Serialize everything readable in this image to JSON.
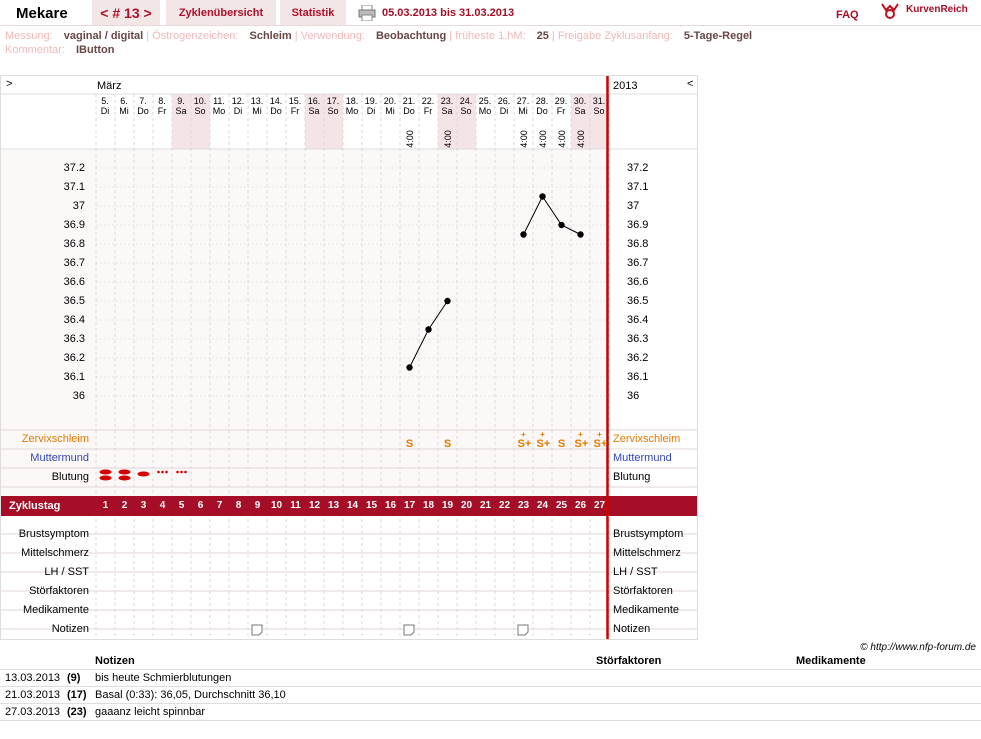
{
  "header": {
    "name": "Mekare",
    "cycle": "< # 13 >",
    "tabs": [
      "Zyklenübersicht",
      "Statistik"
    ],
    "date_range": "05.03.2013 bis 31.03.2013",
    "faq": "FAQ",
    "brand": "KurvenReich"
  },
  "info": {
    "measurement_label": "Messung:",
    "measurement": "vaginal / digital",
    "estrogen_label": "Östrogenzeichen:",
    "estrogen": "Schleim",
    "use_label": "Verwendung:",
    "use": "Beobachtung",
    "earliest_label": "früheste 1.hM:",
    "earliest": "25",
    "release_label": "Freigabe Zyklusanfang:",
    "release": "5-Tage-Regel",
    "comment_label": "Kommentar:",
    "comment": "IButton"
  },
  "chart": {
    "month": "März",
    "year": "2013",
    "nav_left": ">",
    "nav_right": "<",
    "days": [
      {
        "d": "5.",
        "w": "Di",
        "we": false
      },
      {
        "d": "6.",
        "w": "Mi",
        "we": false
      },
      {
        "d": "7.",
        "w": "Do",
        "we": false
      },
      {
        "d": "8.",
        "w": "Fr",
        "we": false
      },
      {
        "d": "9.",
        "w": "Sa",
        "we": true
      },
      {
        "d": "10.",
        "w": "So",
        "we": true
      },
      {
        "d": "11.",
        "w": "Mo",
        "we": false
      },
      {
        "d": "12.",
        "w": "Di",
        "we": false
      },
      {
        "d": "13.",
        "w": "Mi",
        "we": false
      },
      {
        "d": "14.",
        "w": "Do",
        "we": false
      },
      {
        "d": "15.",
        "w": "Fr",
        "we": false
      },
      {
        "d": "16.",
        "w": "Sa",
        "we": true
      },
      {
        "d": "17.",
        "w": "So",
        "we": true
      },
      {
        "d": "18.",
        "w": "Mo",
        "we": false
      },
      {
        "d": "19.",
        "w": "Di",
        "we": false
      },
      {
        "d": "20.",
        "w": "Mi",
        "we": false
      },
      {
        "d": "21.",
        "w": "Do",
        "we": false
      },
      {
        "d": "22.",
        "w": "Fr",
        "we": false
      },
      {
        "d": "23.",
        "w": "Sa",
        "we": true
      },
      {
        "d": "24.",
        "w": "So",
        "we": true
      },
      {
        "d": "25.",
        "w": "Mo",
        "we": false
      },
      {
        "d": "26.",
        "w": "Di",
        "we": false
      },
      {
        "d": "27.",
        "w": "Mi",
        "we": false
      },
      {
        "d": "28.",
        "w": "Do",
        "we": false
      },
      {
        "d": "29.",
        "w": "Fr",
        "we": false
      },
      {
        "d": "30.",
        "w": "Sa",
        "we": true
      },
      {
        "d": "31.",
        "w": "So",
        "we": true
      }
    ],
    "times": [
      {
        "day": 16,
        "t": "4:00"
      },
      {
        "day": 18,
        "t": "4:00"
      },
      {
        "day": 22,
        "t": "4:00"
      },
      {
        "day": 23,
        "t": "4:00"
      },
      {
        "day": 24,
        "t": "4:00"
      },
      {
        "day": 25,
        "t": "4:00"
      }
    ],
    "temp_ticks": [
      "37.2",
      "37.1",
      "37",
      "36.9",
      "36.8",
      "36.7",
      "36.6",
      "36.5",
      "36.4",
      "36.3",
      "36.2",
      "36.1",
      "36"
    ],
    "rows_top": [
      "Zervixschleim",
      "Muttermund",
      "Blutung"
    ],
    "cycle_label": "Zyklustag",
    "cycle_days": [
      "1",
      "2",
      "3",
      "4",
      "5",
      "6",
      "7",
      "8",
      "9",
      "10",
      "11",
      "12",
      "13",
      "14",
      "15",
      "16",
      "17",
      "18",
      "19",
      "20",
      "21",
      "22",
      "23",
      "24",
      "25",
      "26",
      "27"
    ],
    "rows_bottom": [
      "Brustsymptom",
      "Mittelschmerz",
      "LH / SST",
      "Störfaktoren",
      "Medikamente",
      "Notizen"
    ],
    "mucus": [
      {
        "day": 16,
        "sym": "S"
      },
      {
        "day": 18,
        "sym": "S"
      },
      {
        "day": 22,
        "sym": "S+"
      },
      {
        "day": 23,
        "sym": "S+"
      },
      {
        "day": 24,
        "sym": "S"
      },
      {
        "day": 25,
        "sym": "S+"
      },
      {
        "day": 26,
        "sym": "S+"
      }
    ],
    "bleeding": [
      {
        "day": 0,
        "level": "heavy"
      },
      {
        "day": 1,
        "level": "heavy"
      },
      {
        "day": 2,
        "level": "medium"
      },
      {
        "day": 3,
        "level": "spot"
      },
      {
        "day": 4,
        "level": "spot"
      }
    ],
    "note_days": [
      8,
      16,
      22
    ],
    "colors": {
      "accent": "#a50e26",
      "mucus": "#e07a00",
      "cervix": "#3344bb",
      "weekend": "#f5e4e6",
      "grid": "#c8c8c8"
    }
  },
  "chart_data": {
    "type": "line",
    "series": [
      {
        "x": [
          16,
          17,
          18
        ],
        "values": [
          36.15,
          36.35,
          36.5
        ]
      },
      {
        "x": [
          22,
          23,
          24,
          25
        ],
        "values": [
          36.85,
          37.05,
          36.9,
          36.85
        ]
      }
    ],
    "ylim": [
      36,
      37.2
    ]
  },
  "copyright": "© http://www.nfp-forum.de",
  "notes": {
    "headers": [
      "Notizen",
      "Störfaktoren",
      "Medikamente"
    ],
    "rows": [
      {
        "date": "13.03.2013",
        "day": "(9)",
        "note": "bis heute Schmierblutungen"
      },
      {
        "date": "21.03.2013",
        "day": "(17)",
        "note": "Basal (0:33): 36,05, Durchschnitt 36,10"
      },
      {
        "date": "27.03.2013",
        "day": "(23)",
        "note": "gaaanz leicht spinnbar"
      }
    ]
  }
}
